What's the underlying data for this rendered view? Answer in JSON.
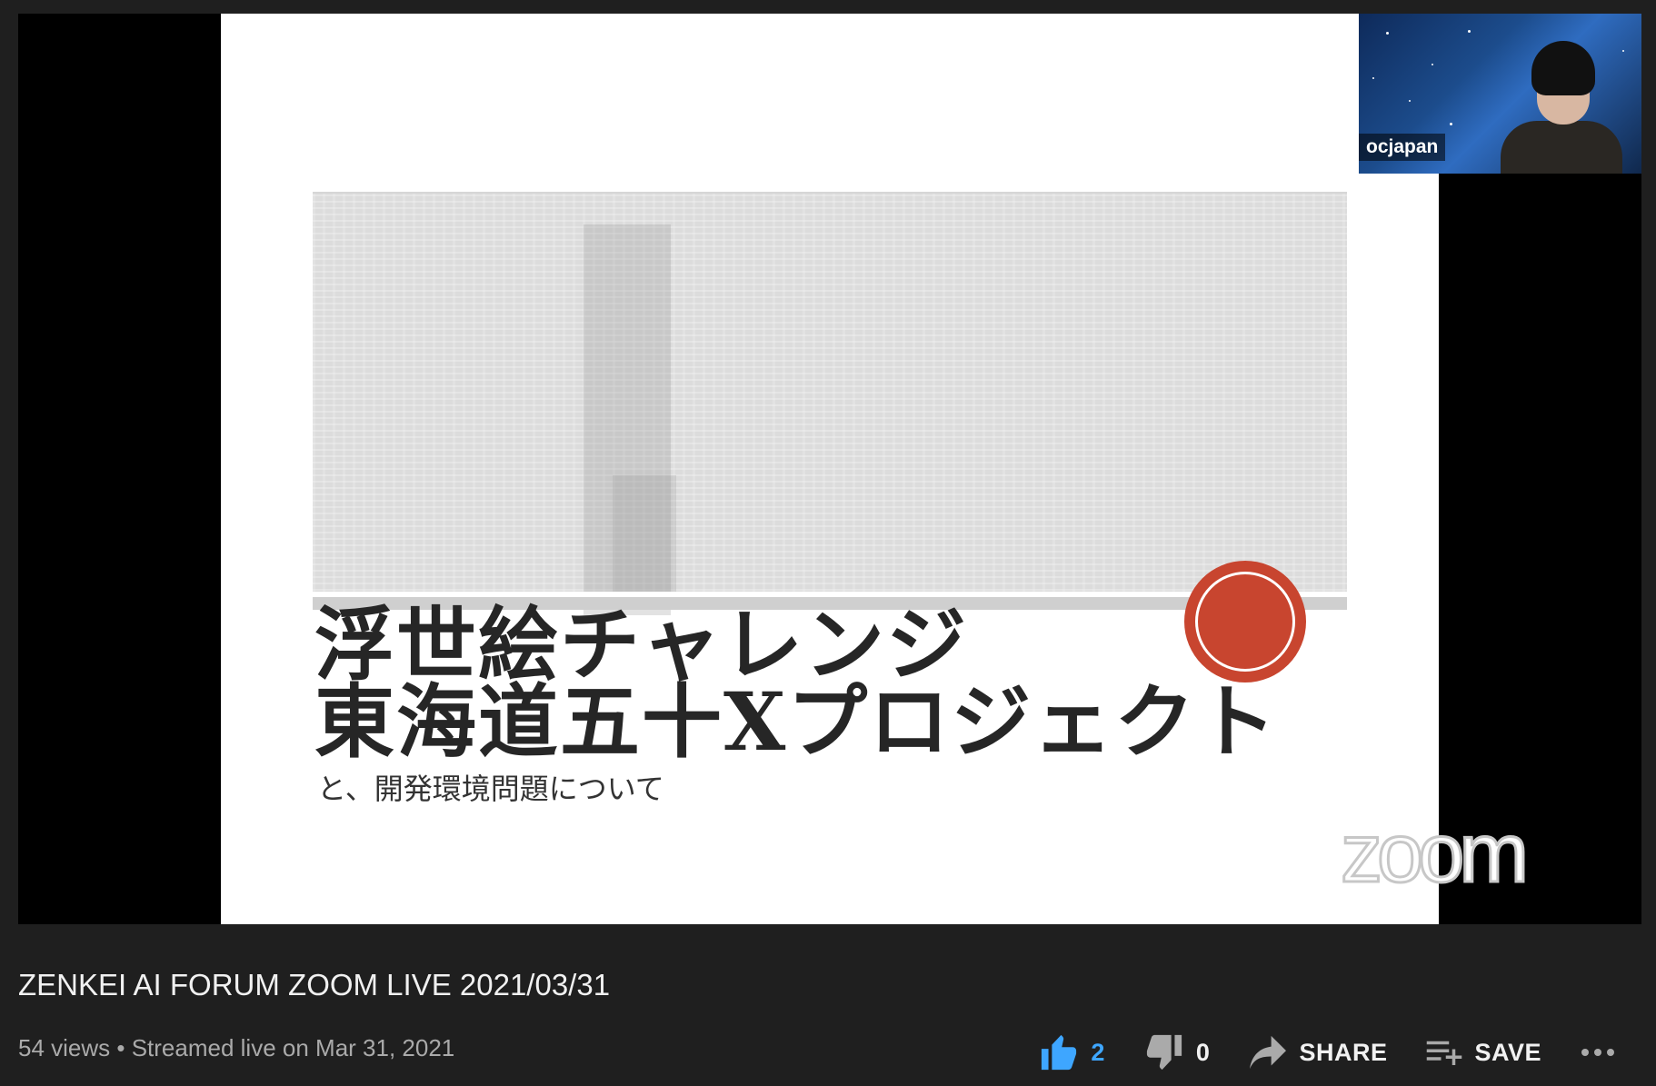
{
  "slide": {
    "title_line1": "浮世絵チャレンジ",
    "title_line2": "東海道五十Xプロジェクト",
    "subtitle": "と、開発環境問題について",
    "watermark": "zoom"
  },
  "camera": {
    "participant_name": "ocjapan"
  },
  "video": {
    "title": "ZENKEI AI FORUM ZOOM LIVE 2021/03/31",
    "meta": "54 views • Streamed live on Mar 31, 2021"
  },
  "actions": {
    "like_count": "2",
    "dislike_count": "0",
    "share_label": "SHARE",
    "save_label": "SAVE"
  },
  "colors": {
    "page_bg": "#1f1f1f",
    "accent_like": "#3ea6ff",
    "seal_red": "#c8452f"
  },
  "icons": [
    "thumb-up-icon",
    "thumb-down-icon",
    "share-arrow-icon",
    "playlist-add-icon",
    "more-horizontal-icon"
  ]
}
